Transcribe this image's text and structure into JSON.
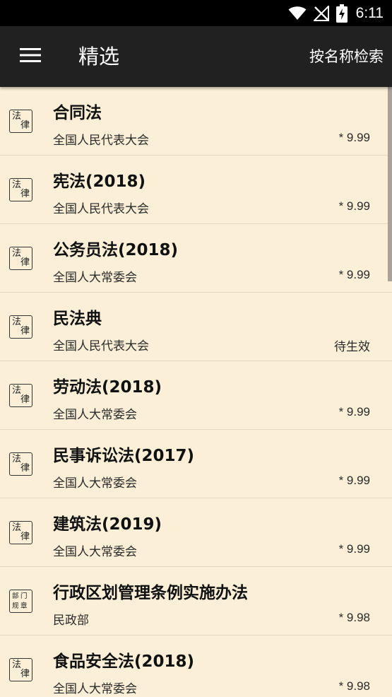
{
  "status_bar": {
    "time": "6:11"
  },
  "app_bar": {
    "title": "精选",
    "search_label": "按名称检索"
  },
  "badges": {
    "law": [
      "法",
      "律"
    ],
    "dept": [
      "部",
      "门",
      "规",
      "章"
    ]
  },
  "items": [
    {
      "title": "合同法",
      "issuer": "全国人民代表大会",
      "status": "* 9.99",
      "badge": "law"
    },
    {
      "title": "宪法(2018)",
      "issuer": "全国人民代表大会",
      "status": "* 9.99",
      "badge": "law"
    },
    {
      "title": "公务员法(2018)",
      "issuer": "全国人大常委会",
      "status": "* 9.99",
      "badge": "law"
    },
    {
      "title": "民法典",
      "issuer": "全国人民代表大会",
      "status": "待生效",
      "badge": "law"
    },
    {
      "title": "劳动法(2018)",
      "issuer": "全国人大常委会",
      "status": "* 9.99",
      "badge": "law"
    },
    {
      "title": "民事诉讼法(2017)",
      "issuer": "全国人大常委会",
      "status": "* 9.99",
      "badge": "law"
    },
    {
      "title": "建筑法(2019)",
      "issuer": "全国人大常委会",
      "status": "* 9.99",
      "badge": "law"
    },
    {
      "title": "行政区划管理条例实施办法",
      "issuer": "民政部",
      "status": "* 9.98",
      "badge": "dept"
    },
    {
      "title": "食品安全法(2018)",
      "issuer": "全国人大常委会",
      "status": "* 9.98",
      "badge": "law"
    }
  ]
}
